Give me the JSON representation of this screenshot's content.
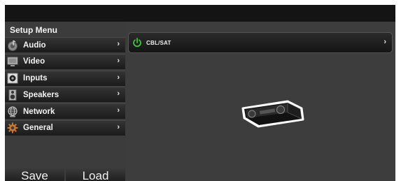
{
  "sidebar": {
    "title": "Setup Menu",
    "items": [
      {
        "label": "Audio",
        "icon": "music-note-icon",
        "chevron": "›"
      },
      {
        "label": "Video",
        "icon": "monitor-icon",
        "chevron": "›"
      },
      {
        "label": "Inputs",
        "icon": "input-jack-icon",
        "chevron": "›"
      },
      {
        "label": "Speakers",
        "icon": "speaker-icon",
        "chevron": "›"
      },
      {
        "label": "Network",
        "icon": "globe-icon",
        "chevron": "›"
      },
      {
        "label": "General",
        "icon": "gear-icon",
        "chevron": "›"
      }
    ],
    "buttons": {
      "save": "Save",
      "load": "Load"
    }
  },
  "content": {
    "source": {
      "label": "CBL/SAT",
      "chevron": "›",
      "power_color": "#3ec43e"
    }
  },
  "colors": {
    "accent": "#3ec43e",
    "icon_orange": "#c8762e"
  }
}
